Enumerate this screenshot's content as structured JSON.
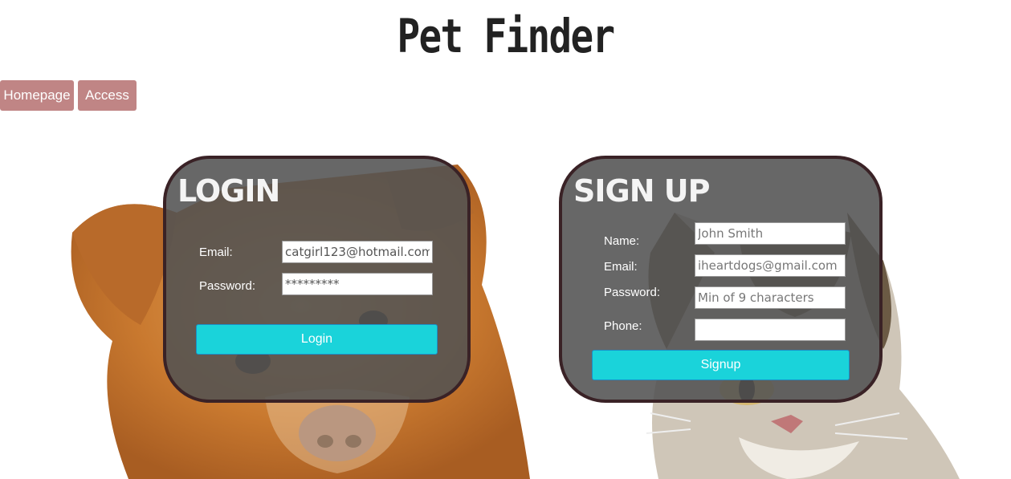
{
  "header": {
    "title": "Pet Finder"
  },
  "nav": {
    "homepage_label": "Homepage",
    "access_label": "Access"
  },
  "login": {
    "title": "LOGIN",
    "email_label": "Email:",
    "email_value": "catgirl123@hotmail.com",
    "password_label": "Password:",
    "password_value": "*********",
    "button_label": "Login"
  },
  "signup": {
    "title": "SIGN UP",
    "name_label": "Name:",
    "name_placeholder": "John Smith",
    "email_label": "Email:",
    "email_placeholder": "iheartdogs@gmail.com",
    "password_label": "Password:",
    "password_placeholder": "Min of 9 characters",
    "phone_label": "Phone:",
    "phone_placeholder": "",
    "button_label": "Signup"
  },
  "colors": {
    "nav_button": "#c08585",
    "action_button": "#1ad3da",
    "panel_border": "#3a2226",
    "panel_fill": "#525252"
  },
  "images": {
    "left": "dog-photo",
    "right": "cat-photo"
  }
}
